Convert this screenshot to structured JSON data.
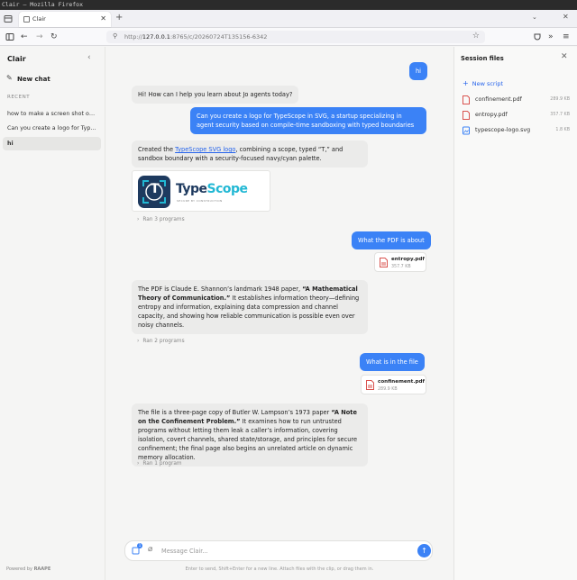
{
  "os": {
    "title": "Clair — Mozilla Firefox"
  },
  "browser": {
    "tab_title": "Clair",
    "url_prefix": "http://",
    "url_host": "127.0.0.1",
    "url_rest": ":8765/c/20260724T135156-6342"
  },
  "sidebar": {
    "brand": "Clair",
    "new_chat": "New chat",
    "recent_label": "RECENT",
    "items": [
      {
        "label": "how to make a screen shot on U..."
      },
      {
        "label": "Can you create a logo for TypeS..."
      },
      {
        "label": "hi"
      }
    ],
    "powered_by": "Powered by",
    "powered_brand": "RAAPE"
  },
  "chat": {
    "m1_user": "hi",
    "m2_ai": "Hi! How can I help you learn about Jo agents today?",
    "m3_user": "Can you create a logo for TypeScope in SVG, a startup specializing in agent security based on compile-time sandboxing with typed boundaries",
    "m4_ai_pre": "Created the ",
    "m4_ai_link": "TypeScope SVG logo",
    "m4_ai_post": ", combining a scope, typed “T,” and sandbox boundary with a security-focused navy/cyan palette.",
    "logo": {
      "word_a": "Type",
      "word_b": "Scope",
      "tagline": "SECURE BY CONSTRUCTION",
      "glyph": "T"
    },
    "ran_1": "Ran 3 programs",
    "m5_user": "What the PDF is about",
    "file_1": {
      "name": "entropy.pdf",
      "size": "357.7 KB"
    },
    "m6_ai_pre": "The PDF is Claude E. Shannon’s landmark 1948 paper, ",
    "m6_ai_bold": "“A Mathematical Theory of Communication.”",
    "m6_ai_post": " It establishes information theory—defining entropy and information, explaining data compression and channel capacity, and showing how reliable communication is possible even over noisy channels.",
    "ran_2": "Ran 2 programs",
    "m7_user": "What is in the file",
    "file_2": {
      "name": "confinement.pdf",
      "size": "289.9 KB"
    },
    "m8_ai_pre": "The file is a three-page copy of Butler W. Lampson’s 1973 paper ",
    "m8_ai_bold": "“A Note on the Confinement Problem.”",
    "m8_ai_post": " It examines how to run untrusted programs without letting them leak a caller’s information, covering isolation, covert channels, shared state/storage, and principles for secure confinement; the final page also begins an unrelated article on dynamic memory allocation.",
    "ran_3": "Ran 1 program",
    "composer_placeholder": "Message Clair...",
    "composer_badge": "1",
    "hint": "Enter to send, Shift+Enter for a new line. Attach files with the clip, or drag them in."
  },
  "panel": {
    "title": "Session files",
    "new_script": "New script",
    "files": [
      {
        "name": "confinement.pdf",
        "size": "289.9 KB",
        "kind": "pdf"
      },
      {
        "name": "entropy.pdf",
        "size": "357.7 KB",
        "kind": "pdf"
      },
      {
        "name": "typescope-logo.svg",
        "size": "1.8 KB",
        "kind": "image"
      }
    ]
  },
  "colors": {
    "accent": "#3b82f6",
    "navy": "#1e3a5f",
    "cyan": "#22b8d4",
    "pdf_red": "#d9534f"
  }
}
